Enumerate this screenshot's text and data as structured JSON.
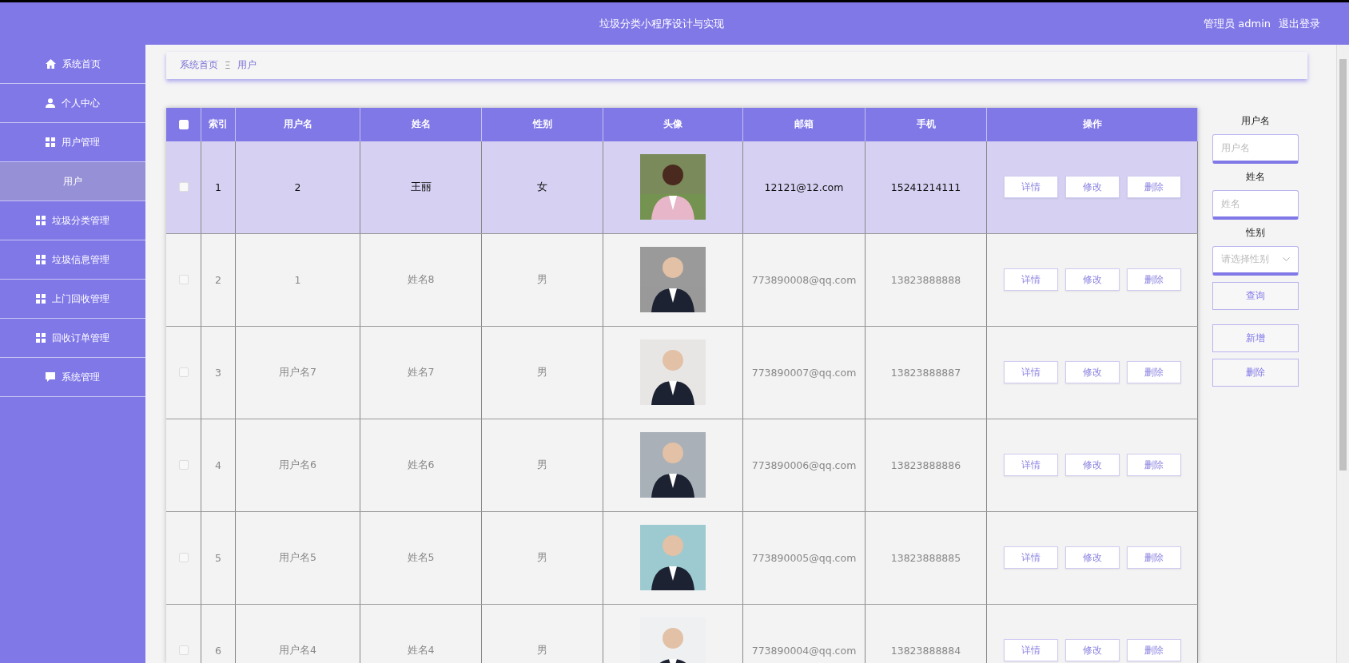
{
  "header": {
    "title": "垃圾分类小程序设计与实现",
    "role": "管理员 admin",
    "logout": "退出登录"
  },
  "sidebar": {
    "items": [
      {
        "label": "系统首页",
        "kind": "home",
        "selected": false
      },
      {
        "label": "个人中心",
        "kind": "user",
        "selected": false
      },
      {
        "label": "用户管理",
        "kind": "grid",
        "selected": false
      },
      {
        "label": "用户",
        "kind": "sub",
        "selected": true
      },
      {
        "label": "垃圾分类管理",
        "kind": "grid",
        "selected": false
      },
      {
        "label": "垃圾信息管理",
        "kind": "grid",
        "selected": false
      },
      {
        "label": "上门回收管理",
        "kind": "grid",
        "selected": false
      },
      {
        "label": "回收订单管理",
        "kind": "grid",
        "selected": false
      },
      {
        "label": "系统管理",
        "kind": "chat",
        "selected": false
      }
    ]
  },
  "breadcrumb": {
    "items": [
      "系统首页",
      "用户"
    ],
    "separator": "Ξ"
  },
  "table": {
    "header_checked": false,
    "columns": [
      "索引",
      "用户名",
      "姓名",
      "性别",
      "头像",
      "邮箱",
      "手机",
      "操作"
    ],
    "rows": [
      {
        "selected": true,
        "checked": false,
        "index": "1",
        "username": "2",
        "name": "王丽",
        "gender": "女",
        "email": "12121@12.com",
        "phone": "15241214111",
        "actions": [
          "详情",
          "修改",
          "删除"
        ]
      },
      {
        "selected": false,
        "checked": false,
        "index": "2",
        "username": "1",
        "name": "姓名8",
        "gender": "男",
        "email": "773890008@qq.com",
        "phone": "13823888888",
        "actions": [
          "详情",
          "修改",
          "删除"
        ]
      },
      {
        "selected": false,
        "checked": false,
        "index": "3",
        "username": "用户名7",
        "name": "姓名7",
        "gender": "男",
        "email": "773890007@qq.com",
        "phone": "13823888887",
        "actions": [
          "详情",
          "修改",
          "删除"
        ]
      },
      {
        "selected": false,
        "checked": false,
        "index": "4",
        "username": "用户名6",
        "name": "姓名6",
        "gender": "男",
        "email": "773890006@qq.com",
        "phone": "13823888886",
        "actions": [
          "详情",
          "修改",
          "删除"
        ]
      },
      {
        "selected": false,
        "checked": false,
        "index": "5",
        "username": "用户名5",
        "name": "姓名5",
        "gender": "男",
        "email": "773890005@qq.com",
        "phone": "13823888885",
        "actions": [
          "详情",
          "修改",
          "删除"
        ]
      },
      {
        "selected": false,
        "checked": false,
        "index": "6",
        "username": "用户名4",
        "name": "姓名4",
        "gender": "男",
        "email": "773890004@qq.com",
        "phone": "13823888884",
        "actions": [
          "详情",
          "修改",
          "删除"
        ]
      }
    ]
  },
  "search": {
    "fields": [
      {
        "label": "用户名",
        "kind": "input",
        "placeholder": "用户名"
      },
      {
        "label": "姓名",
        "kind": "input",
        "placeholder": "姓名"
      },
      {
        "label": "性别",
        "kind": "select",
        "placeholder": "请选择性别"
      }
    ],
    "query_button": "查询",
    "buttons": [
      "新增",
      "删除"
    ]
  }
}
